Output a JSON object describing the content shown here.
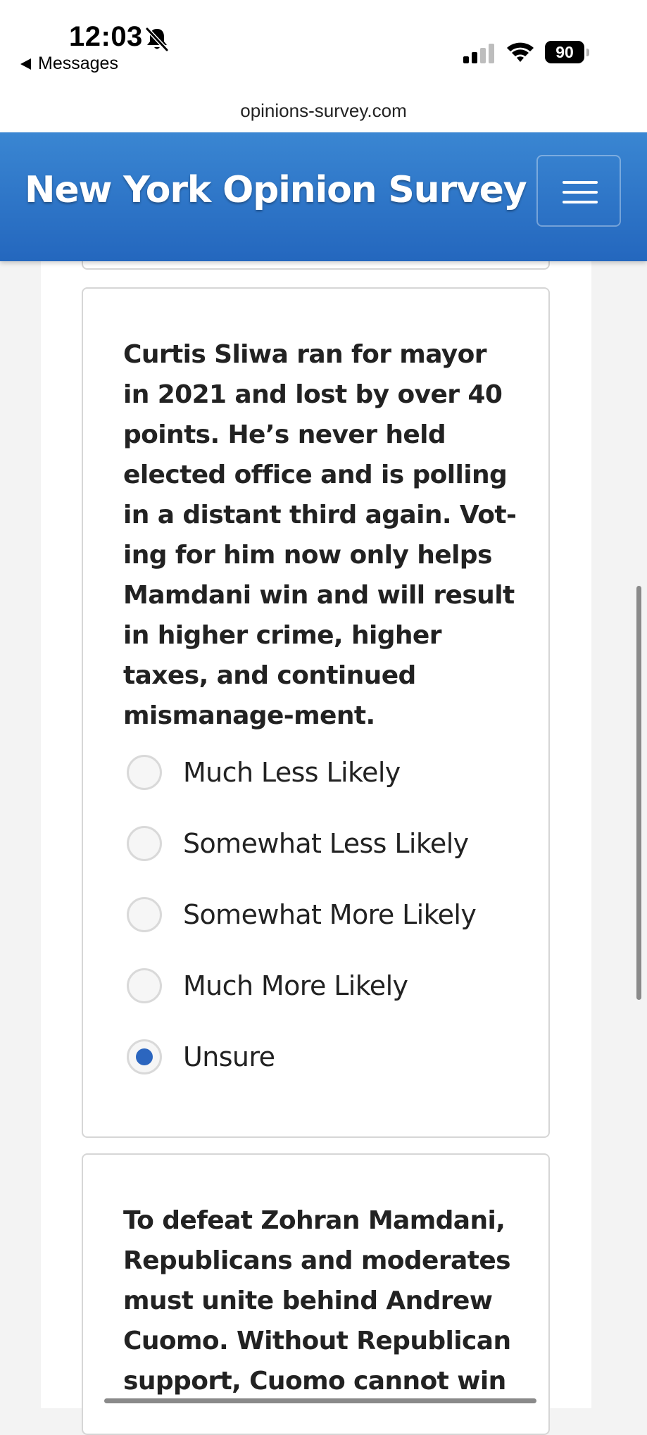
{
  "status_bar": {
    "time": "12:03",
    "back_label": "Messages",
    "battery_level": "90",
    "signal_bars_active": 2,
    "signal_bars_total": 4
  },
  "browser": {
    "url": "opinions-survey.com"
  },
  "header": {
    "title": "New York Opinion Survey",
    "background_color": "#2f75c8",
    "menu_icon": "hamburger-icon"
  },
  "question": {
    "text": "Curtis Sliwa ran for mayor in 2021 and lost by over 40 points. He’s never held elected office and is polling in a distant third again. Vot-ing for him now only helps Mamdani win and will result in higher crime, higher taxes, and continued mismanage-ment.",
    "options": [
      {
        "label": "Much Less Likely",
        "selected": false
      },
      {
        "label": "Somewhat Less Likely",
        "selected": false
      },
      {
        "label": "Somewhat More Likely",
        "selected": false
      },
      {
        "label": "Much More Likely",
        "selected": false
      },
      {
        "label": "Unsure",
        "selected": true
      }
    ],
    "selected_color": "#2c66bf"
  },
  "next_question": {
    "text": "To defeat Zohran Mamdani, Republicans and moderates must unite behind Andrew Cuomo. Without Republican support, Cuomo cannot win"
  }
}
